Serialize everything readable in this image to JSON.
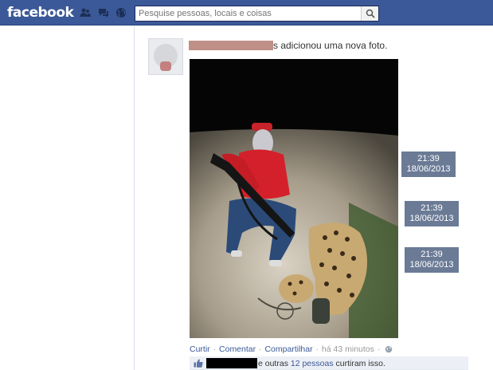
{
  "topbar": {
    "logo": "facebook",
    "search_placeholder": "Pesquise pessoas, locais e coisas",
    "icons": [
      "friend-requests-icon",
      "messages-icon",
      "notifications-globe-icon",
      "search-icon"
    ],
    "colors": {
      "bar": "#3b5998",
      "link": "#3b5998"
    }
  },
  "story": {
    "author_redacted": true,
    "action_text": "s adicionou uma nova foto."
  },
  "timestamps": [
    {
      "time": "21:39",
      "date": "18/06/2013"
    },
    {
      "time": "21:39",
      "date": "18/06/2013"
    },
    {
      "time": "21:39",
      "date": "18/06/2013"
    }
  ],
  "actions": {
    "like": "Curtir",
    "comment": "Comentar",
    "share": "Compartilhar",
    "time_ago": "há 43 minutos",
    "separator": "·"
  },
  "likes": {
    "likers_redacted": true,
    "text_prefix": "e outras ",
    "others_link": "12 pessoas",
    "text_suffix": " curtiram isso."
  }
}
